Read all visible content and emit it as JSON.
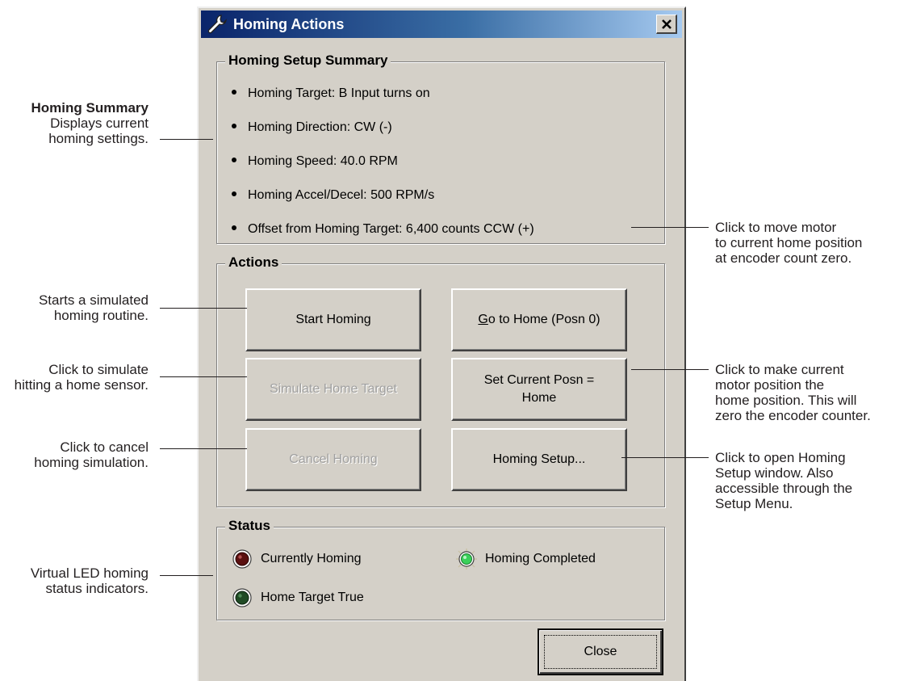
{
  "window": {
    "title": "Homing Actions",
    "close_icon": "close-x-icon",
    "title_icon": "wrench-icon"
  },
  "summary": {
    "heading": "Homing Setup Summary",
    "items": [
      "Homing Target: B Input turns on",
      "Homing Direction: CW (-)",
      "Homing Speed: 40.0 RPM",
      "Homing Accel/Decel: 500 RPM/s",
      "Offset from Homing Target: 6,400 counts CCW (+)"
    ]
  },
  "actions": {
    "heading": "Actions",
    "start_homing": "Start Homing",
    "go_home_mnemonic": "G",
    "go_home_rest": "o to Home (Posn 0)",
    "simulate_target": "Simulate Home Target",
    "set_current_line1": "Set Current Posn =",
    "set_current_line2": "Home",
    "cancel_homing": "Cancel Homing",
    "homing_setup": "Homing Setup..."
  },
  "status": {
    "heading": "Status",
    "currently_homing": "Currently Homing",
    "homing_completed": "Homing Completed",
    "home_target_true": "Home Target True"
  },
  "footer": {
    "close": "Close"
  },
  "annotations": {
    "summary_title": "Homing Summary",
    "summary_line1": "Displays current",
    "summary_line2": "homing settings.",
    "start_line1": "Starts a simulated",
    "start_line2": "homing routine.",
    "simulate_line1": "Click to simulate",
    "simulate_line2": "hitting a home sensor.",
    "cancel_line1": "Click to cancel",
    "cancel_line2": "homing simulation.",
    "led_line1": "Virtual LED homing",
    "led_line2": "status indicators.",
    "gohome_line1": "Click to move motor",
    "gohome_line2": "to current home position",
    "gohome_line3": "at encoder count zero.",
    "setcur_line1": "Click to make current",
    "setcur_line2": "motor position the",
    "setcur_line3": "home position. This will",
    "setcur_line4": "zero the encoder counter.",
    "setup_line1": "Click to open Homing",
    "setup_line2": "Setup window. Also",
    "setup_line3": "accessible through the",
    "setup_line4": "Setup Menu."
  },
  "colors": {
    "dialog_bg": "#d4d0c8",
    "titlebar_start": "#0a246a",
    "titlebar_end": "#a6caf0",
    "led_off_red": "#5a1010",
    "led_off_green": "#1f4a24",
    "led_on_green": "#3ad05a"
  }
}
